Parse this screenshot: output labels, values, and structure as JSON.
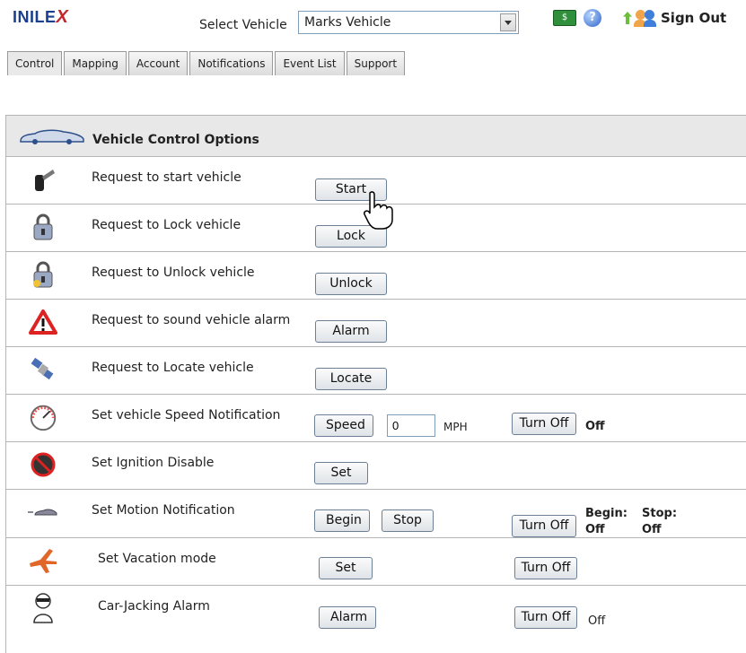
{
  "header": {
    "logo_main": "INILE",
    "logo_x": "X",
    "select_label": "Select Vehicle",
    "selected_vehicle": "Marks Vehicle",
    "sign_out_label": "Sign Out"
  },
  "icons": {
    "money": "money-icon",
    "help": "help-icon",
    "signout": "sign-out-icon",
    "dropdown": "chevron-down-icon"
  },
  "tabs": [
    {
      "label": "Control",
      "active": true
    },
    {
      "label": "Mapping"
    },
    {
      "label": "Account"
    },
    {
      "label": "Notifications"
    },
    {
      "label": "Event List"
    },
    {
      "label": "Support"
    }
  ],
  "panel": {
    "title": "Vehicle Control Options"
  },
  "rows": [
    {
      "label": "Request to start vehicle",
      "button": "Start",
      "icon": "key-icon"
    },
    {
      "label": "Request to Lock vehicle",
      "button": "Lock",
      "icon": "lock-icon"
    },
    {
      "label": "Request to Unlock vehicle",
      "button": "Unlock",
      "icon": "unlock-icon"
    },
    {
      "label": "Request to sound vehicle alarm",
      "button": "Alarm",
      "icon": "warning-icon"
    },
    {
      "label": "Request to Locate vehicle",
      "button": "Locate",
      "icon": "satellite-icon"
    },
    {
      "label": "Set vehicle Speed Notification",
      "button": "Speed",
      "speed_value": "0",
      "unit": "MPH",
      "turn_off": "Turn Off",
      "status": "Off",
      "icon": "speedometer-icon"
    },
    {
      "label": "Set Ignition Disable",
      "button": "Set",
      "icon": "ignition-disable-icon"
    },
    {
      "label": "Set Motion Notification",
      "button": "Begin",
      "button2": "Stop",
      "turn_off": "Turn Off",
      "begin_label": "Begin:",
      "begin_value": "Off",
      "stop_label": "Stop:",
      "stop_value": "Off",
      "icon": "motion-car-icon"
    },
    {
      "label": "Set Vacation mode",
      "button": "Set",
      "turn_off": "Turn Off",
      "icon": "airplane-icon"
    },
    {
      "label": "Car-Jacking Alarm",
      "button": "Alarm",
      "turn_off": "Turn Off",
      "status": "Off",
      "icon": "carjacker-icon"
    }
  ],
  "colors": {
    "logo_blue": "#1b3f8f",
    "logo_red": "#c1272d",
    "header_bg": "#e8e8e8",
    "border": "#b5b5b5"
  }
}
